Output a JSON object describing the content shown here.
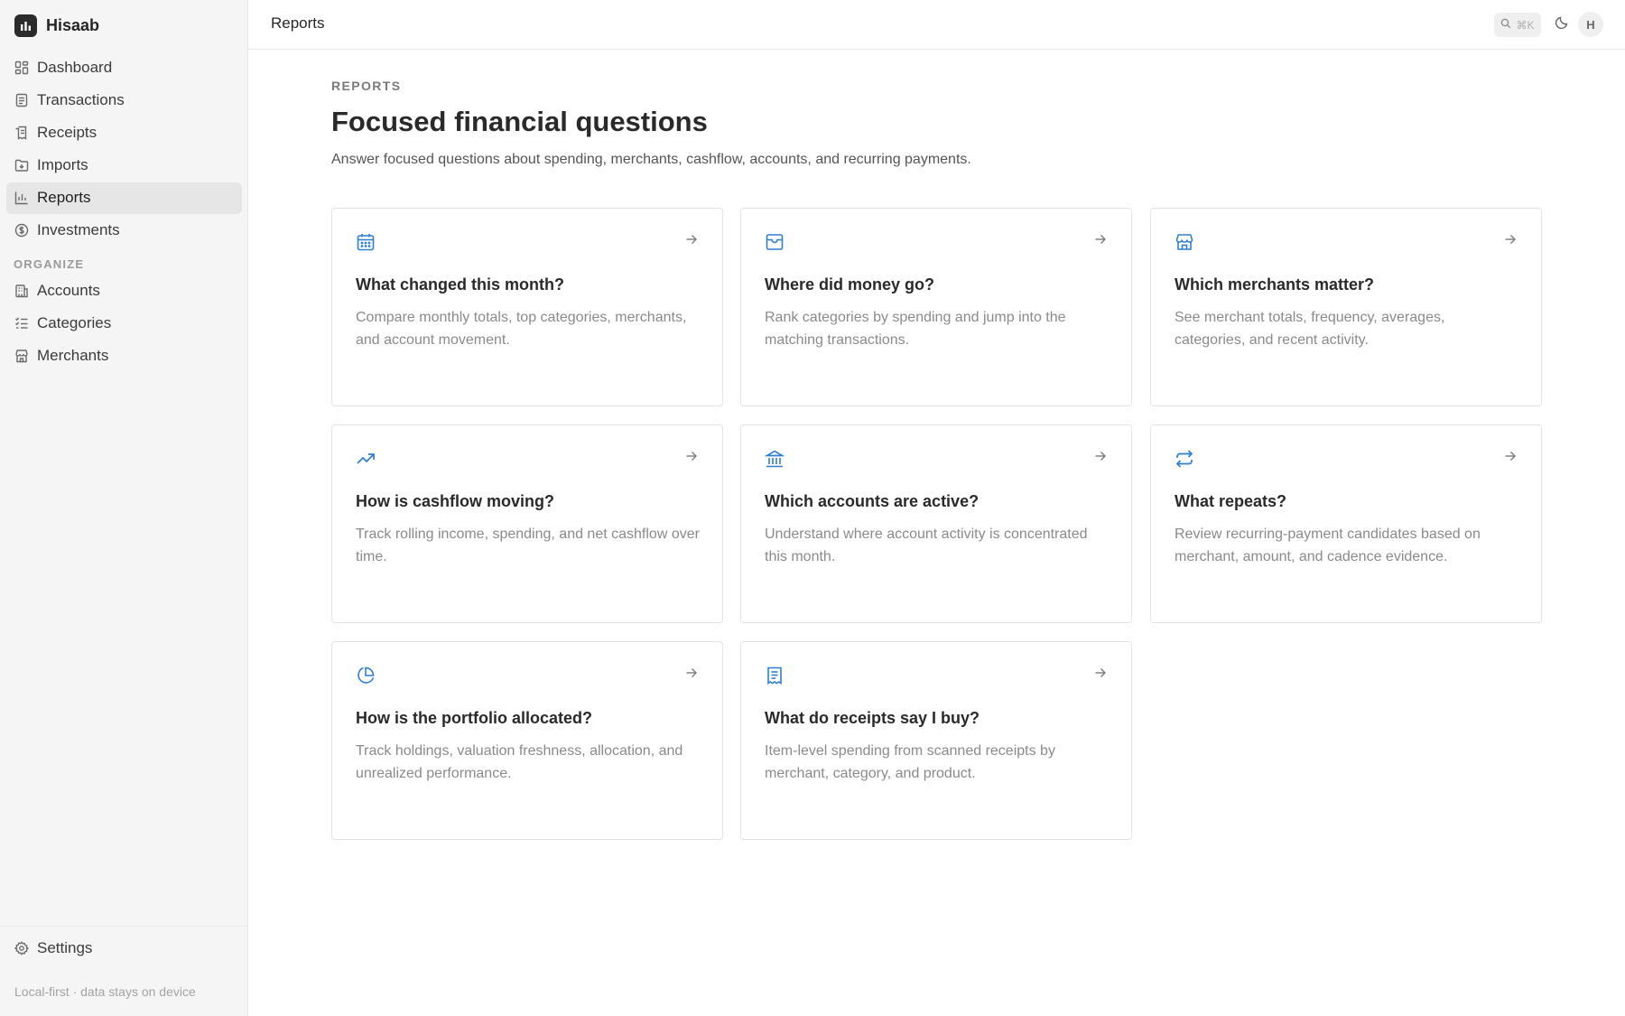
{
  "app": {
    "name": "Hisaab"
  },
  "sidebar": {
    "items": [
      {
        "label": "Dashboard",
        "icon": "dashboard-icon"
      },
      {
        "label": "Transactions",
        "icon": "document-icon"
      },
      {
        "label": "Receipts",
        "icon": "receipt-icon"
      },
      {
        "label": "Imports",
        "icon": "folder-import-icon"
      },
      {
        "label": "Reports",
        "icon": "bar-chart-icon",
        "active": true
      },
      {
        "label": "Investments",
        "icon": "dollar-circle-icon"
      }
    ],
    "section_label": "ORGANIZE",
    "organize_items": [
      {
        "label": "Accounts",
        "icon": "bank-icon"
      },
      {
        "label": "Categories",
        "icon": "list-icon"
      },
      {
        "label": "Merchants",
        "icon": "store-icon"
      }
    ],
    "settings_label": "Settings",
    "footnote": "Local-first · data stays on device"
  },
  "topbar": {
    "title": "Reports",
    "search_shortcut": "⌘K",
    "avatar_initial": "H"
  },
  "main": {
    "eyebrow": "REPORTS",
    "title": "Focused financial questions",
    "description": "Answer focused questions about spending, merchants, cashflow, accounts, and recurring payments.",
    "cards": [
      {
        "title": "What changed this month?",
        "description": "Compare monthly totals, top categories, merchants, and account movement.",
        "icon": "calendar-icon"
      },
      {
        "title": "Where did money go?",
        "description": "Rank categories by spending and jump into the matching transactions.",
        "icon": "wallet-icon"
      },
      {
        "title": "Which merchants matter?",
        "description": "See merchant totals, frequency, averages, categories, and recent activity.",
        "icon": "store-icon"
      },
      {
        "title": "How is cashflow moving?",
        "description": "Track rolling income, spending, and net cashflow over time.",
        "icon": "trending-up-icon"
      },
      {
        "title": "Which accounts are active?",
        "description": "Understand where account activity is concentrated this month.",
        "icon": "bank-icon"
      },
      {
        "title": "What repeats?",
        "description": "Review recurring-payment candidates based on merchant, amount, and cadence evidence.",
        "icon": "repeat-icon"
      },
      {
        "title": "How is the portfolio allocated?",
        "description": "Track holdings, valuation freshness, allocation, and unrealized performance.",
        "icon": "pie-chart-icon"
      },
      {
        "title": "What do receipts say I buy?",
        "description": "Item-level spending from scanned receipts by merchant, category, and product.",
        "icon": "receipt-icon"
      }
    ]
  },
  "colors": {
    "accent": "#2f7fd1",
    "sidebar_bg": "#f5f5f5",
    "active_bg": "#e6e6e6"
  }
}
